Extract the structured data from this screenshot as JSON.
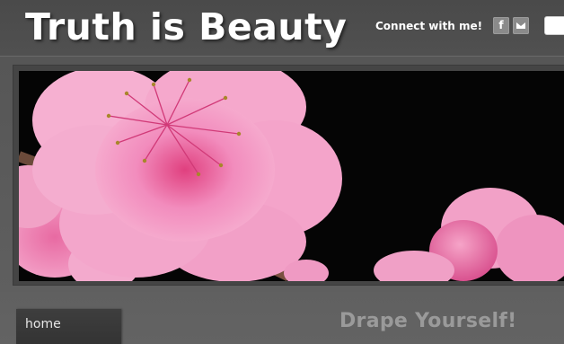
{
  "header": {
    "site_title": "Truth is Beauty",
    "connect_label": "Connect with me!",
    "social": [
      {
        "name": "facebook",
        "glyph": "f",
        "icon": "facebook-icon"
      },
      {
        "name": "email",
        "glyph": "",
        "icon": "mail-icon"
      }
    ],
    "search": {
      "value": "",
      "placeholder": ""
    }
  },
  "hero": {
    "image_subject": "pink cherry blossom on black background"
  },
  "nav": {
    "items": [
      {
        "label": "home"
      }
    ]
  },
  "main": {
    "heading": "Drape Yourself!"
  },
  "colors": {
    "background": "#5e5e5e",
    "title_text": "#ffffff",
    "heading_text": "#9a9a9a",
    "social_button": "#8a8a8a",
    "nav_tab": "#383838",
    "blossom_pink": "#f08fc0"
  }
}
